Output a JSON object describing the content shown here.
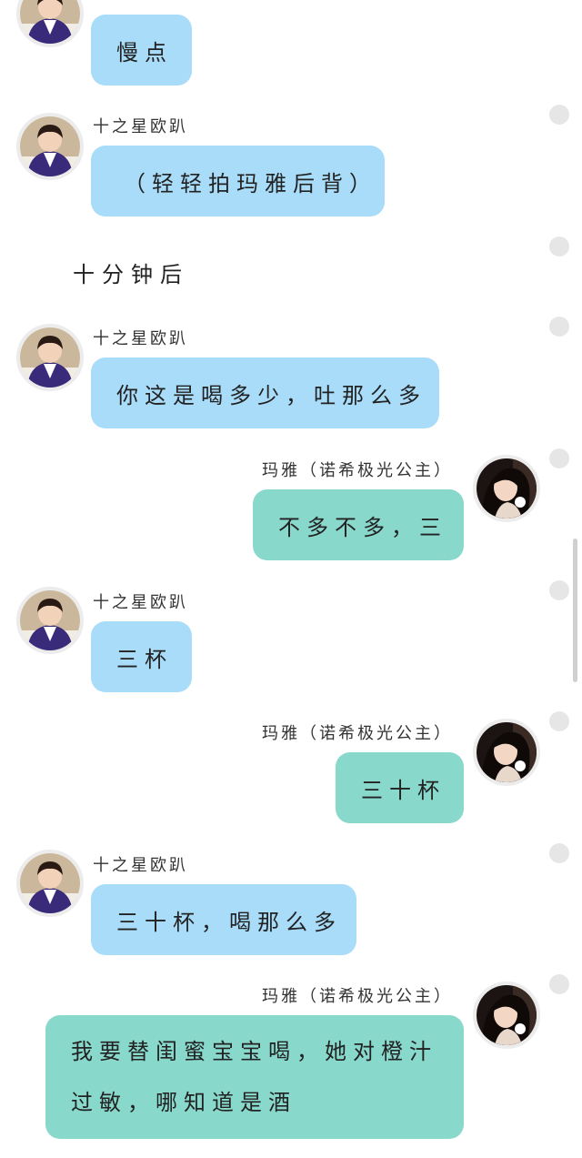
{
  "messages": [
    {
      "side": "left",
      "name": "",
      "text": "慢点"
    },
    {
      "side": "left",
      "name": "十之星欧趴",
      "text": "（轻轻拍玛雅后背）"
    },
    {
      "narration": "十分钟后"
    },
    {
      "side": "left",
      "name": "十之星欧趴",
      "text": "你这是喝多少，吐那么多"
    },
    {
      "side": "right",
      "name": "玛雅（诺希极光公主）",
      "text": "不多不多，三"
    },
    {
      "side": "left",
      "name": "十之星欧趴",
      "text": "三杯"
    },
    {
      "side": "right",
      "name": "玛雅（诺希极光公主）",
      "text": "三十杯"
    },
    {
      "side": "left",
      "name": "十之星欧趴",
      "text": "三十杯，喝那么多"
    },
    {
      "side": "right",
      "name": "玛雅（诺希极光公主）",
      "text": "我要替闺蜜宝宝喝，她对橙汁过敏，哪知道是酒"
    }
  ],
  "colors": {
    "left_bubble": "#a9dcf8",
    "right_bubble": "#88d8cc",
    "avatar_border": "#ececec"
  },
  "icons": {
    "left_avatar": "boy-avatar-icon",
    "right_avatar": "girl-avatar-icon",
    "status_dot": "status-dot-icon"
  }
}
